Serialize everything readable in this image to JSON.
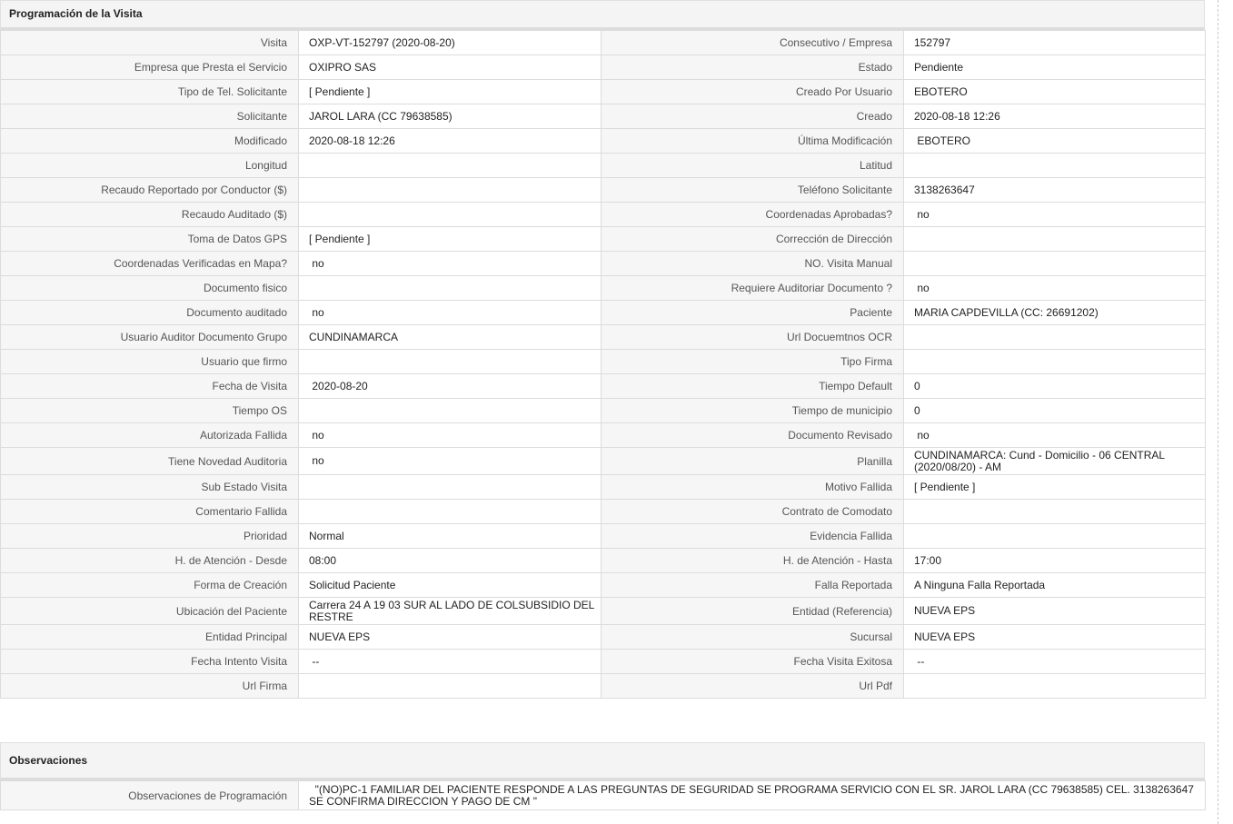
{
  "programacion": {
    "title": "Programación de la Visita",
    "rows": [
      {
        "l1": "Visita",
        "v1": "OXP-VT-152797 (2020-08-20)",
        "l2": "Consecutivo / Empresa",
        "v2": "152797"
      },
      {
        "l1": "Empresa que Presta el Servicio",
        "v1": "OXIPRO SAS",
        "l2": "Estado",
        "v2": "Pendiente"
      },
      {
        "l1": "Tipo de Tel. Solicitante",
        "v1": "[ Pendiente ]",
        "l2": "Creado Por Usuario",
        "v2": "EBOTERO"
      },
      {
        "l1": "Solicitante",
        "v1": "JAROL LARA (CC 79638585)",
        "l2": "Creado",
        "v2": "2020-08-18 12:26"
      },
      {
        "l1": "Modificado",
        "v1": "2020-08-18 12:26",
        "l2": "Última Modificación",
        "v2": " EBOTERO"
      },
      {
        "l1": "Longitud",
        "v1": "",
        "l2": "Latitud",
        "v2": ""
      },
      {
        "l1": "Recaudo Reportado por Conductor ($)",
        "v1": "",
        "l2": "Teléfono Solicitante",
        "v2": "3138263647"
      },
      {
        "l1": "Recaudo Auditado ($)",
        "v1": "",
        "l2": "Coordenadas Aprobadas?",
        "v2": " no"
      },
      {
        "l1": "Toma de Datos GPS",
        "v1": "[ Pendiente ]",
        "l2": "Corrección de Dirección",
        "v2": ""
      },
      {
        "l1": "Coordenadas Verificadas en Mapa?",
        "v1": " no",
        "l2": "NO. Visita Manual",
        "v2": ""
      },
      {
        "l1": "Documento fisico",
        "v1": "",
        "l2": "Requiere Auditoriar Documento ?",
        "v2": " no"
      },
      {
        "l1": "Documento auditado",
        "v1": " no",
        "l2": "Paciente",
        "v2": "MARIA CAPDEVILLA (CC: 26691202)"
      },
      {
        "l1": "Usuario Auditor Documento Grupo",
        "v1": "CUNDINAMARCA",
        "l2": "Url Docuemtnos OCR",
        "v2": ""
      },
      {
        "l1": "Usuario que firmo",
        "v1": "",
        "l2": "Tipo Firma",
        "v2": ""
      },
      {
        "l1": "Fecha de Visita",
        "v1": " 2020-08-20",
        "l2": "Tiempo Default",
        "v2": "0"
      },
      {
        "l1": "Tiempo OS",
        "v1": "",
        "l2": "Tiempo de municipio",
        "v2": "0"
      },
      {
        "l1": "Autorizada Fallida",
        "v1": " no",
        "l2": "Documento Revisado",
        "v2": " no"
      },
      {
        "l1": "Tiene Novedad Auditoria",
        "v1": " no",
        "l2": "Planilla",
        "v2": "CUNDINAMARCA: Cund - Domicilio - 06 CENTRAL (2020/08/20) - AM",
        "tall": true
      },
      {
        "l1": "Sub Estado Visita",
        "v1": "",
        "l2": "Motivo Fallida",
        "v2": "[ Pendiente ]"
      },
      {
        "l1": "Comentario Fallida",
        "v1": "",
        "l2": "Contrato de Comodato",
        "v2": ""
      },
      {
        "l1": "Prioridad",
        "v1": "Normal",
        "l2": "Evidencia Fallida",
        "v2": ""
      },
      {
        "l1": "H. de Atención - Desde",
        "v1": "08:00",
        "l2": "H. de Atención - Hasta",
        "v2": "17:00"
      },
      {
        "l1": "Forma de Creación",
        "v1": "Solicitud Paciente",
        "l2": "Falla Reportada",
        "v2": "A Ninguna Falla Reportada"
      },
      {
        "l1": "Ubicación del Paciente",
        "v1": "Carrera 24 A 19 03 SUR AL LADO DE COLSUBSIDIO DEL RESTRE",
        "l2": "Entidad (Referencia)",
        "v2": "NUEVA EPS",
        "tall": true
      },
      {
        "l1": "Entidad Principal",
        "v1": "NUEVA EPS",
        "l2": "Sucursal",
        "v2": "NUEVA EPS"
      },
      {
        "l1": "Fecha Intento Visita",
        "v1": " --",
        "l2": "Fecha Visita Exitosa",
        "v2": " --"
      },
      {
        "l1": "Url Firma",
        "v1": "",
        "l2": "Url Pdf",
        "v2": ""
      }
    ]
  },
  "observaciones": {
    "title": "Observaciones",
    "label": "Observaciones de Programación",
    "value": "  \"(NO)PC-1 FAMILIAR DEL PACIENTE RESPONDE A LAS PREGUNTAS DE SEGURIDAD SE PROGRAMA SERVICIO CON EL SR. JAROL LARA (CC 79638585) CEL. 3138263647 SE CONFIRMA DIRECCION Y PAGO DE CM \""
  }
}
